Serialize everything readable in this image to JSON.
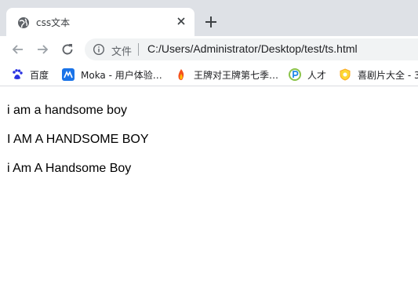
{
  "tab": {
    "title": "css文本"
  },
  "address_bar": {
    "scheme_label": "文件",
    "url": "C:/Users/Administrator/Desktop/test/ts.html"
  },
  "bookmarks": [
    {
      "label": "百度",
      "icon": "baidu-paw-icon"
    },
    {
      "label": "Moka - 用户体验…",
      "icon": "moka-icon"
    },
    {
      "label": "王牌对王牌第七季…",
      "icon": "flame-icon"
    },
    {
      "label": "人才",
      "icon": "p-logo-icon"
    },
    {
      "label": "喜剧片大全 - 3",
      "icon": "shield-icon"
    }
  ],
  "content": {
    "line1": "i am a handsome boy",
    "line2": "i am a handsome boy",
    "line3": "i am a handsome boy"
  },
  "colors": {
    "tabstrip": "#dee1e6",
    "omnibox": "#f1f3f4",
    "text": "#000000"
  }
}
